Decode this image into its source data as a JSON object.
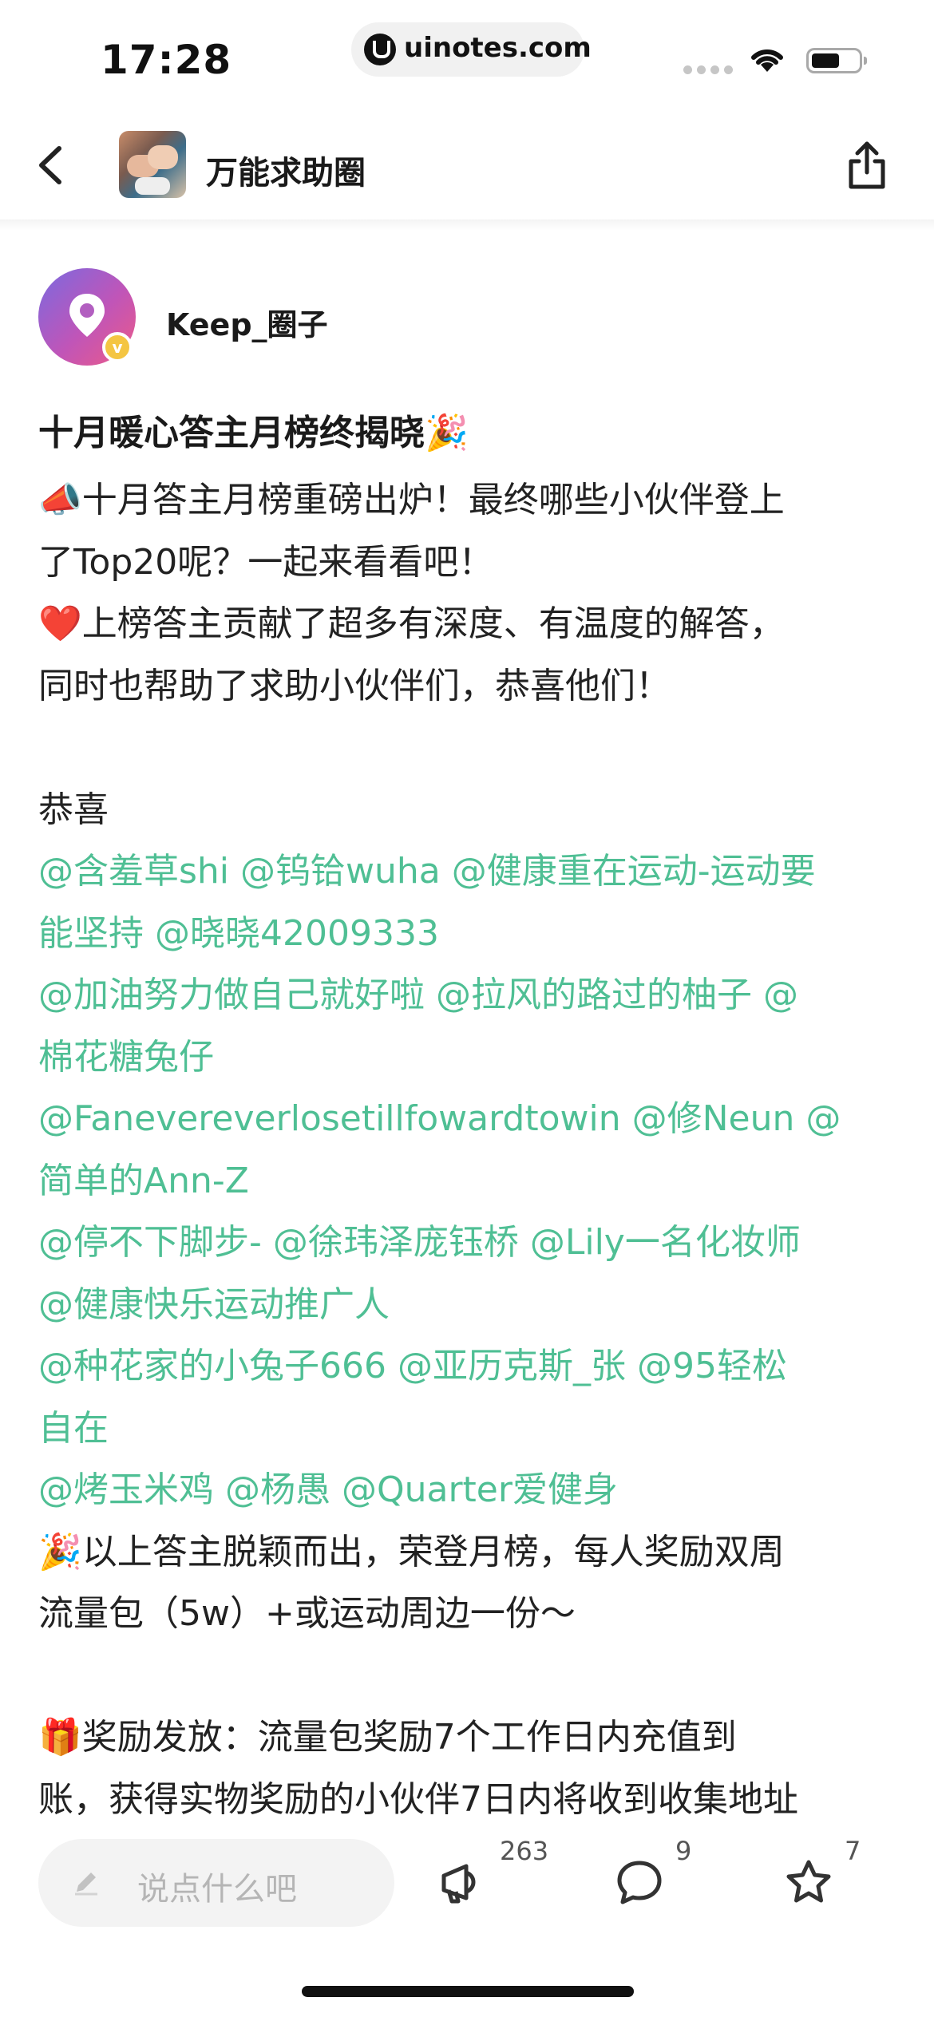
{
  "status_bar": {
    "time": "17:28",
    "url": "uinotes.com",
    "battery_level": 0.6
  },
  "nav": {
    "group_name": "万能求助圈",
    "back_icon": "chevron-left-icon",
    "share_icon": "share-icon"
  },
  "author": {
    "name": "Keep_圈子",
    "badge": "v"
  },
  "post": {
    "title": "十月暖心答主月榜终揭晓",
    "title_emoji": "🎉",
    "lines": [
      {
        "segments": [
          {
            "text": "📣",
            "emoji": true
          },
          {
            "text": "十月答主月榜重磅出炉！最终哪些小伙伴登上"
          }
        ]
      },
      {
        "segments": [
          {
            "text": "了Top20呢？一起来看看吧！"
          }
        ]
      },
      {
        "segments": [
          {
            "text": "❤️",
            "emoji": true
          },
          {
            "text": "上榜答主贡献了超多有深度、有温度的解答，"
          }
        ]
      },
      {
        "segments": [
          {
            "text": "同时也帮助了求助小伙伴们，恭喜他们！"
          }
        ]
      },
      {
        "segments": [
          {
            "text": ""
          }
        ]
      },
      {
        "segments": [
          {
            "text": "恭喜"
          }
        ]
      },
      {
        "segments": [
          {
            "text": "@含羞草shi @钨铪wuha @健康重在运动-运动要",
            "mention": true
          }
        ]
      },
      {
        "segments": [
          {
            "text": "能坚持 @晓晓42009333",
            "mention": true
          }
        ]
      },
      {
        "segments": [
          {
            "text": "@加油努力做自己就好啦 @拉风的路过的柚子 @",
            "mention": true
          }
        ]
      },
      {
        "segments": [
          {
            "text": "棉花糖兔仔",
            "mention": true
          }
        ]
      },
      {
        "segments": [
          {
            "text": "@Fanevereverlosetillfowardtowin @修Neun @",
            "mention": true
          }
        ]
      },
      {
        "segments": [
          {
            "text": "简单的Ann-Z",
            "mention": true
          }
        ]
      },
      {
        "segments": [
          {
            "text": "@停不下脚步- @徐玮泽庞钰桥 @Lily一名化妆师",
            "mention": true
          }
        ]
      },
      {
        "segments": [
          {
            "text": "@健康快乐运动推广人",
            "mention": true
          }
        ]
      },
      {
        "segments": [
          {
            "text": "@种花家的小兔子666 @亚历克斯_张 @95轻松",
            "mention": true
          }
        ]
      },
      {
        "segments": [
          {
            "text": "自在",
            "mention": true
          }
        ]
      },
      {
        "segments": [
          {
            "text": "@烤玉米鸡 @杨愚 @Quarter爱健身",
            "mention": true
          }
        ]
      },
      {
        "segments": [
          {
            "text": "🎉",
            "emoji": true
          },
          {
            "text": "以上答主脱颖而出，荣登月榜，每人奖励双周"
          }
        ]
      },
      {
        "segments": [
          {
            "text": "流量包（5w）+或运动周边一份～"
          }
        ]
      },
      {
        "segments": [
          {
            "text": ""
          }
        ]
      },
      {
        "segments": [
          {
            "text": "🎁",
            "emoji": true
          },
          {
            "text": "奖励发放：流量包奖励7个工作日内充值到"
          }
        ]
      },
      {
        "segments": [
          {
            "text": "账，获得实物奖励的小伙伴7日内将收到收集地址"
          }
        ]
      }
    ],
    "mention_color": "#4fbf94"
  },
  "bottom_bar": {
    "comment_placeholder": "说点什么吧",
    "cheer_count": "263",
    "comment_count": "9",
    "favorite_count": "7"
  }
}
